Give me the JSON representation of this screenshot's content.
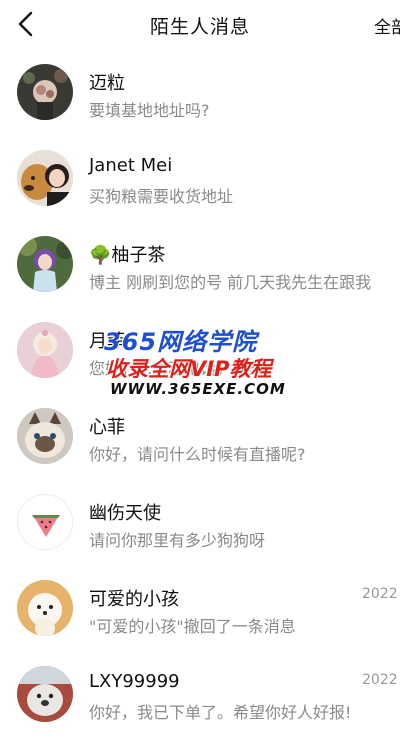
{
  "header": {
    "title": "陌生人消息",
    "action": "全部"
  },
  "conversations": [
    {
      "name": "迈粒",
      "preview": "要填基地地址吗?",
      "time": "",
      "avatar_icon": "avatar-flowers-icon"
    },
    {
      "name": "Janet Mei",
      "preview": "买狗粮需要收货地址",
      "time": "",
      "avatar_icon": "avatar-dog-woman-icon"
    },
    {
      "name": "柚子茶",
      "name_emoji": "🌳",
      "preview": "博主 刚刷到您的号 前几天我先生在跟我",
      "time": "",
      "avatar_icon": "avatar-doll-icon"
    },
    {
      "name": "月菲",
      "preview": "您好，...对和电话，我家",
      "time": "",
      "avatar_icon": "avatar-princess-icon"
    },
    {
      "name": "心菲",
      "preview": "你好，请问什么时候有直播呢?",
      "time": "",
      "avatar_icon": "avatar-cat-icon"
    },
    {
      "name": "幽伤天使",
      "preview": "请问你那里有多少狗狗呀",
      "time": "",
      "avatar_icon": "avatar-watermelon-icon"
    },
    {
      "name": "可爱的小孩",
      "preview": "\"可爱的小孩\"撤回了一条消息",
      "time": "2022",
      "avatar_icon": "avatar-pomeranian-icon"
    },
    {
      "name": "LXY99999",
      "preview": "你好，我已下单了。希望你好人好报!",
      "time": "2022",
      "avatar_icon": "avatar-seal-icon"
    }
  ],
  "watermark": {
    "line1": "365网络学院",
    "line2": "收录全网VIP教程",
    "line3": "WWW.365EXE.COM"
  },
  "colors": {
    "text_primary": "#111111",
    "text_secondary": "#8a8a8a",
    "watermark_blue": "#1f4fd1",
    "watermark_red": "#e0201b"
  }
}
